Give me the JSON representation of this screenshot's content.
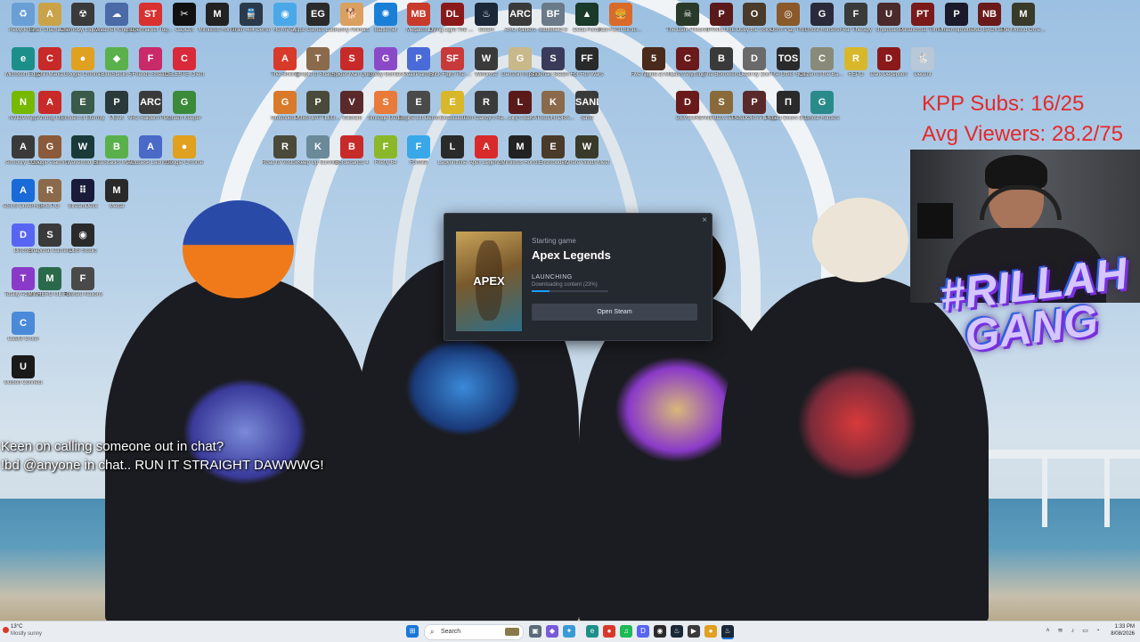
{
  "desktop": {
    "icons": [
      {
        "label": "Recycle Bin",
        "glyph": "♻",
        "color": "#6a9fd6"
      },
      {
        "label": "Bitter Chameleon",
        "glyph": "A",
        "color": "#caa349"
      },
      {
        "label": "Chernobyl Liquidators",
        "glyph": "☢",
        "color": "#3a3a3a"
      },
      {
        "label": "Weather Kingdom",
        "glyph": "☁",
        "color": "#4a6aa8"
      },
      {
        "label": "Supermarket Together",
        "glyph": "ST",
        "color": "#d93030"
      },
      {
        "label": "CapCut",
        "glyph": "✂",
        "color": "#111111"
      },
      {
        "label": "Mimikrus Horror",
        "glyph": "M",
        "color": "#222222"
      },
      {
        "label": "Train 404 Demo",
        "glyph": "🚆",
        "color": "#2a3a4a"
      },
      {
        "label": "HoYoPlay",
        "glyph": "◉",
        "color": "#4aa8e8"
      },
      {
        "label": "Epic Games Launcher",
        "glyph": "EG",
        "color": "#2a2a2a"
      },
      {
        "label": "Funny Animals",
        "glyph": "🐕",
        "color": "#d9a060"
      },
      {
        "label": "Battle.net",
        "glyph": "✺",
        "color": "#1a7fd6"
      },
      {
        "label": "Megabonk",
        "glyph": "MB",
        "color": "#c83a2a"
      },
      {
        "label": "Dying Light The Beast",
        "glyph": "DL",
        "color": "#8a1a1a"
      },
      {
        "label": "Steam",
        "glyph": "♨",
        "color": "#1b2838"
      },
      {
        "label": "ARC Raiders",
        "glyph": "ARC",
        "color": "#3a3a3a"
      },
      {
        "label": "Battlefield 6",
        "glyph": "BF",
        "color": "#6a7a88"
      },
      {
        "label": "Delta Force",
        "glyph": "▲",
        "color": "#1a3a2a"
      },
      {
        "label": "Fast Food Simulator",
        "glyph": "🍔",
        "color": "#d86a2a"
      },
      {
        "label": "The Dark Pictures",
        "glyph": "☠",
        "color": "#2a3a2a"
      },
      {
        "label": "PANICORE",
        "glyph": "P",
        "color": "#5a1a1a"
      },
      {
        "label": "Obey the Voice",
        "glyph": "O",
        "color": "#4a3a2a"
      },
      {
        "label": "Don't Play This",
        "glyph": "◎",
        "color": "#8a5a2a"
      },
      {
        "label": "Ghost Hunters",
        "glyph": "G",
        "color": "#2a2a3a"
      },
      {
        "label": "Fear Therapy",
        "glyph": "F",
        "color": "#3a3a3a"
      },
      {
        "label": "Unpossess",
        "glyph": "U",
        "color": "#4a2a2a"
      },
      {
        "label": "Paranormal Tormenter",
        "glyph": "PT",
        "color": "#7a1a1a"
      },
      {
        "label": "Phasmophobia",
        "glyph": "P",
        "color": "#1a1a2a"
      },
      {
        "label": "NO BACKUP",
        "glyph": "NB",
        "color": "#6a1a1a"
      },
      {
        "label": "The Mound Omen of Cthulhu",
        "glyph": "M",
        "color": "#3a3a2a"
      },
      {
        "label": "Microsoft Edge",
        "glyph": "e",
        "color": "#1d8f8b"
      },
      {
        "label": "Chili Mania",
        "glyph": "C",
        "color": "#c82a2a"
      },
      {
        "label": "Google Chrome",
        "glyph": "●",
        "color": "#e0a020"
      },
      {
        "label": "BlueStacks 5",
        "glyph": "◆",
        "color": "#5ab04a"
      },
      {
        "label": "Friends Stream",
        "glyph": "F",
        "color": "#c82a6a"
      },
      {
        "label": "CELESTE Client",
        "glyph": "C",
        "color": "#d82a3a"
      },
      {
        "label": "The Sinking",
        "glyph": "A",
        "color": "#d83a2a"
      },
      {
        "label": "Temple of Shadows",
        "glyph": "T",
        "color": "#8a6a4a"
      },
      {
        "label": "Spider-Man Quiz",
        "glyph": "S",
        "color": "#c82a2a"
      },
      {
        "label": "Goofy Gorillas",
        "glyph": "G",
        "color": "#8a4ac8"
      },
      {
        "label": "PeakPlanner",
        "glyph": "P",
        "color": "#4a6ad8"
      },
      {
        "label": "Stick Fight The Game",
        "glyph": "SF",
        "color": "#c83a3a"
      },
      {
        "label": "Windrose",
        "glyph": "W",
        "color": "#3a3a3a"
      },
      {
        "label": "Genshin Impact",
        "glyph": "G",
        "color": "#c8b88a"
      },
      {
        "label": "Stickman Steam Demo",
        "glyph": "S",
        "color": "#3a3a5a"
      },
      {
        "label": "For Fun Wars",
        "glyph": "FF",
        "color": "#2a2a2a"
      },
      {
        "label": "Five Nights at Midnight",
        "glyph": "5",
        "color": "#4a2a1a"
      },
      {
        "label": "Cash Anything",
        "glyph": "C",
        "color": "#6a1a1a"
      },
      {
        "label": "The Borrowers",
        "glyph": "B",
        "color": "#3a3a3a"
      },
      {
        "label": "Dead by Zoo",
        "glyph": "D",
        "color": "#6a6a6a"
      },
      {
        "label": "The Other Side",
        "glyph": "TOS",
        "color": "#2a2a2a"
      },
      {
        "label": "Citizen of the Backrooms",
        "glyph": "C",
        "color": "#8a8a7a"
      },
      {
        "label": "REPO",
        "glyph": "R",
        "color": "#d8b82a"
      },
      {
        "label": "Dark Deception",
        "glyph": "D",
        "color": "#8a1a1a"
      },
      {
        "label": "Decent",
        "glyph": "🐇",
        "color": "#b8c8d8"
      },
      {
        "label": "NVIDIA App",
        "glyph": "N",
        "color": "#76b900"
      },
      {
        "label": "Among Us",
        "glyph": "A",
        "color": "#c82a2a"
      },
      {
        "label": "Echoes of Eternity",
        "glyph": "E",
        "color": "#3a5a4a"
      },
      {
        "label": "PEAK",
        "glyph": "P",
        "color": "#2a3a3a"
      },
      {
        "label": "ARC Raiders Playtest",
        "glyph": "ARC",
        "color": "#3a3a3a"
      },
      {
        "label": "Green Keeper",
        "glyph": "G",
        "color": "#3a8a3a"
      },
      {
        "label": "Grounded 2",
        "glyph": "G",
        "color": "#d87a2a"
      },
      {
        "label": "PUBG BATTLEGROUNDS",
        "glyph": "P",
        "color": "#4a4a3a"
      },
      {
        "label": "Valorant",
        "glyph": "V",
        "color": "#5a2a2a"
      },
      {
        "label": "Smudge Demo",
        "glyph": "S",
        "color": "#e87a3a"
      },
      {
        "label": "Engine Lift Demo",
        "glyph": "E",
        "color": "#4a4a4a"
      },
      {
        "label": "Excavated",
        "glyph": "E",
        "color": "#d8b82a"
      },
      {
        "label": "Tom Clancy's Rainbow Six",
        "glyph": "R",
        "color": "#3a3a3a"
      },
      {
        "label": "Lilly's Bar",
        "glyph": "L",
        "color": "#5a1a1a"
      },
      {
        "label": "KATSUCHI DRAGON",
        "glyph": "K",
        "color": "#8a6a4a"
      },
      {
        "label": "Sand",
        "glyph": "SAND",
        "color": "#3a3a3a"
      },
      {
        "label": "DEVOUR",
        "glyph": "D",
        "color": "#6a1a1a"
      },
      {
        "label": "SANDBOX APPRENTICE",
        "glyph": "S",
        "color": "#8a6a3a"
      },
      {
        "label": "PANDORA PLACE",
        "glyph": "P",
        "color": "#5a2a2a"
      },
      {
        "label": "Project Doors Demo",
        "glyph": "Π",
        "color": "#2a2a2a"
      },
      {
        "label": "Ghost Hunters",
        "glyph": "G",
        "color": "#2a8a8a"
      },
      {
        "label": "Armoury Crate",
        "glyph": "A",
        "color": "#3a3a3a"
      },
      {
        "label": "Google Alarmist",
        "glyph": "G",
        "color": "#8a5a3a"
      },
      {
        "label": "Wavemod 16",
        "glyph": "W",
        "color": "#1a3a3a"
      },
      {
        "label": "BlueStacks Multi-Instance",
        "glyph": "B",
        "color": "#5ab04a"
      },
      {
        "label": "Autodesk Launcher",
        "glyph": "A",
        "color": "#4a6ac8"
      },
      {
        "label": "Google Chrome",
        "glyph": "●",
        "color": "#e0a020"
      },
      {
        "label": "Road to Vostok Demo",
        "glyph": "R",
        "color": "#4a4a3a"
      },
      {
        "label": "Keep Up Survival",
        "glyph": "K",
        "color": "#6a8a9a"
      },
      {
        "label": "Borderlands 4",
        "glyph": "B",
        "color": "#c82a2a"
      },
      {
        "label": "Firefly 64",
        "glyph": "F",
        "color": "#8ab82a"
      },
      {
        "label": "Fortnite",
        "glyph": "F",
        "color": "#3aa8e8"
      },
      {
        "label": "Labyrinthine",
        "glyph": "L",
        "color": "#2a2a2a"
      },
      {
        "label": "Apex Legends",
        "glyph": "A",
        "color": "#d82a2a"
      },
      {
        "label": "Mimikrus Horror",
        "glyph": "M",
        "color": "#222222"
      },
      {
        "label": "Enshrouded",
        "glyph": "E",
        "color": "#4a3a2a"
      },
      {
        "label": "Where Winds Meet",
        "glyph": "W",
        "color": "#3a3a2a"
      },
      {
        "label": "ASUS DriverHub",
        "glyph": "A",
        "color": "#1a6ad8"
      },
      {
        "label": "R.E.P.O",
        "glyph": "R",
        "color": "#8a6a4a"
      },
      {
        "label": "StreamDeck",
        "glyph": "⠿",
        "color": "#1a1a3a"
      },
      {
        "label": "Medal",
        "glyph": "M",
        "color": "#2a2a2a"
      },
      {
        "label": "Discord",
        "glyph": "D",
        "color": "#5865f2"
      },
      {
        "label": "Snapchat Camera",
        "glyph": "S",
        "color": "#3a3a3a"
      },
      {
        "label": "OBS Studio",
        "glyph": "◉",
        "color": "#2a2a2a"
      },
      {
        "label": "Totally Accurate",
        "glyph": "T",
        "color": "#8a3ac8"
      },
      {
        "label": "MY HERO ULTRA",
        "glyph": "M",
        "color": "#2a6a4a"
      },
      {
        "label": "Forward Nations",
        "glyph": "F",
        "color": "#4a4a4a"
      },
      {
        "label": "Castle Crush",
        "glyph": "C",
        "color": "#4a8ad8"
      },
      {
        "label": "Ubisoft Connect",
        "glyph": "U",
        "color": "#1a1a1a"
      }
    ]
  },
  "overlay": {
    "kpp_subs": "KPP Subs: 16/25",
    "avg_viewers": "Avg Viewers: 28.2/75",
    "brand_line1": "#RILLAH",
    "brand_line2": "GANG",
    "chat_line1": "Keen on calling someone out in chat?",
    "chat_line2": "!bd @anyone in chat.. RUN IT STRAIGHT DAWWWG!"
  },
  "steam_popup": {
    "subtitle": "Starting game",
    "game_title": "Apex Legends",
    "cover_text": "APEX",
    "status": "LAUNCHING",
    "detail": "Downloading content (23%)",
    "progress": 0.23,
    "button_label": "Open Steam",
    "close_glyph": "×"
  },
  "taskbar": {
    "weather_temp": "13°C",
    "weather_desc": "Mostly sunny",
    "search_placeholder": "Search",
    "time": "1:33 PM",
    "date": "8/08/2026",
    "pinned": [
      "start",
      "search-highlight",
      "task-view",
      "widgets",
      "copilot",
      "edge",
      "file-explorer",
      "chrome",
      "spotify",
      "discord",
      "obs",
      "steam",
      "media",
      "chrome",
      "steam"
    ]
  },
  "colors": {
    "kpp_red": "#e32a2a",
    "steam_bg": "#24282f",
    "steam_accent": "#1a9fff",
    "taskbar_bg": "#e9edf2"
  }
}
